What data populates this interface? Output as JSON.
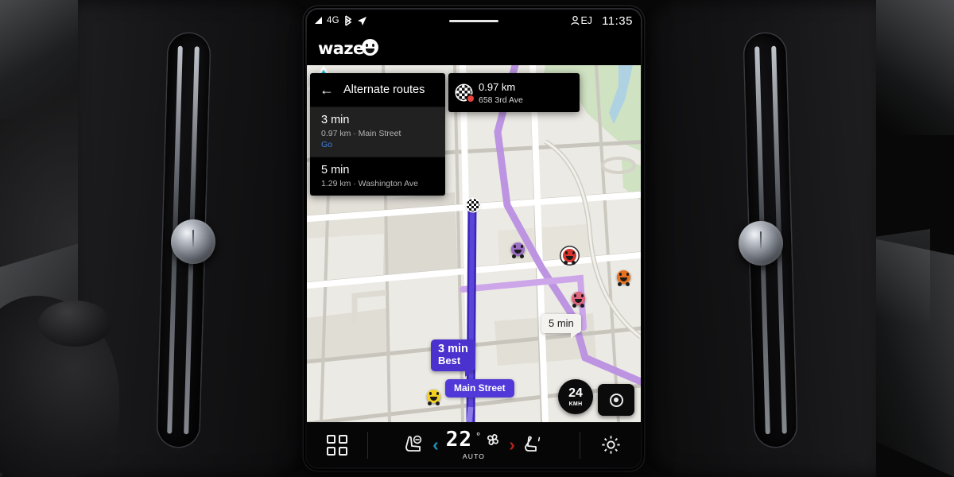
{
  "statusbar": {
    "signal_icon": "signal-triangle-icon",
    "network": "4G",
    "bluetooth_icon": "bluetooth-icon",
    "location_icon": "navigation-arrow-icon",
    "profile_icon": "person-icon",
    "profile_initials": "EJ",
    "time": "11:35"
  },
  "app": {
    "name": "waze",
    "logo_icon": "waze-wazer-face-icon"
  },
  "alternate_routes": {
    "back_icon": "back-arrow-icon",
    "title": "Alternate routes",
    "routes": [
      {
        "eta": "3 min",
        "detail": "0.97 km · Main Street",
        "action": "Go",
        "selected": true
      },
      {
        "eta": "5 min",
        "detail": "1.29 km · Washington Ave",
        "action": "",
        "selected": false
      }
    ]
  },
  "destination_card": {
    "icon": "checkered-flag-icon",
    "distance": "0.97 km",
    "address": "658 3rd Ave"
  },
  "map": {
    "background_color": "#eceae4",
    "park_color": "#cfe2c2",
    "water_color": "#a9cfe8",
    "road_color": "#ffffff",
    "route_primary_color": "#4b32cf",
    "route_alternate_color": "#c79ae8",
    "labels": {
      "best_eta": "3 min",
      "best_tag": "Best",
      "alt_eta": "5 min",
      "current_street": "Main Street"
    },
    "destination_flag_icon": "checkered-flag-map-icon",
    "vehicle_icon": "vehicle-arrow-icon",
    "markers": [
      {
        "name": "wazer-purple",
        "mood": "purple"
      },
      {
        "name": "wazer-red-alert",
        "mood": "red"
      },
      {
        "name": "wazer-orange",
        "mood": "orange"
      },
      {
        "name": "wazer-pink",
        "mood": "pink"
      },
      {
        "name": "wazer-laughing",
        "mood": "yellow"
      },
      {
        "name": "wazer-heart",
        "mood": "teal"
      }
    ],
    "speed": {
      "value": "24",
      "unit": "KMH"
    },
    "recenter_icon": "recenter-icon"
  },
  "climate_bar": {
    "apps_icon": "app-grid-icon",
    "driver_seat_icon": "seat-heater-icon",
    "temp_down_icon": "chevron-left-icon",
    "temp_down_color": "#1e90b4",
    "temperature": "22",
    "degree_symbol": "°",
    "fan_icon": "fan-icon",
    "auto_label": "AUTO",
    "temp_up_icon": "chevron-right-icon",
    "temp_up_color": "#b4231e",
    "passenger_seat_icon": "seat-icon",
    "settings_icon": "gear-icon"
  }
}
